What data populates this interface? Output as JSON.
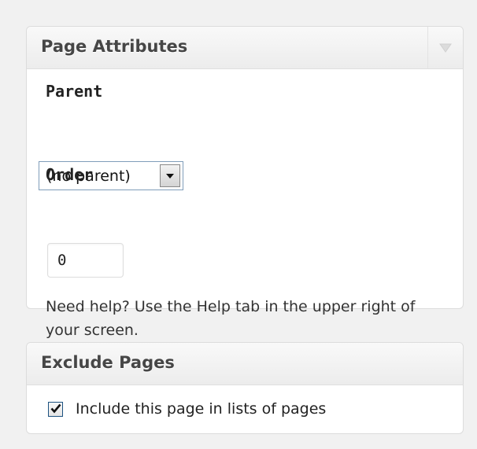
{
  "page_attributes": {
    "title": "Page Attributes",
    "parent_label": "Parent",
    "parent_select_value": "(no parent)",
    "order_label": "Order",
    "order_value": "0",
    "help_text": "Need help? Use the Help tab in the upper right of your screen."
  },
  "exclude_pages": {
    "title": "Exclude Pages",
    "checkbox_label": "Include this page in lists of pages",
    "checkbox_checked": true
  },
  "icons": {
    "toggle": "chevron-down-icon",
    "select_arrow": "dropdown-arrow-icon",
    "checkmark": "checkmark-icon"
  },
  "colors": {
    "background": "#f1f1f1",
    "panel": "#ffffff",
    "header_text": "#464646",
    "border": "#dcdcdc"
  }
}
